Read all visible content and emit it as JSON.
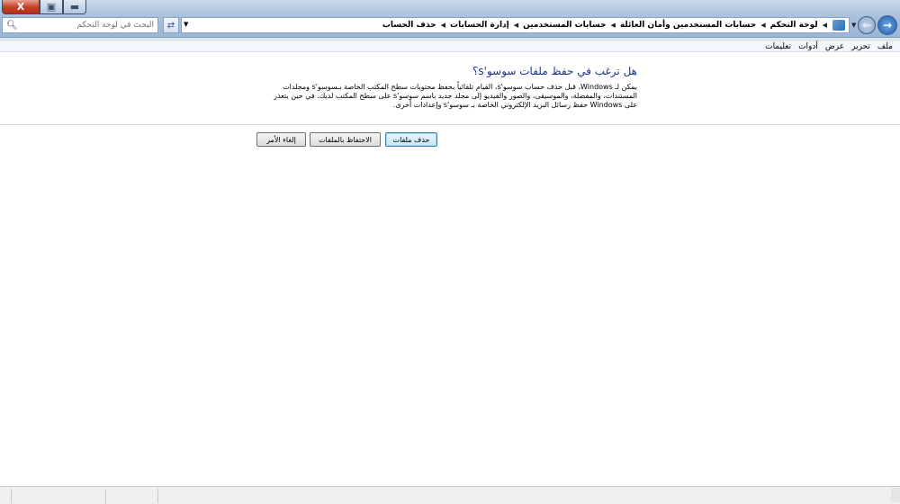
{
  "window": {
    "close_symbol": "X",
    "maximize_symbol": "▣",
    "minimize_symbol": "▬"
  },
  "search": {
    "placeholder": "البحث في لوحة التحكم"
  },
  "address": {
    "crumbs": [
      "لوحة التحكم",
      "حسابات المستخدمين وأمان العائلة",
      "حسابات المستخدمين",
      "إدارة الحسابات",
      "حذف الحساب"
    ]
  },
  "menu": {
    "items": [
      "ملف",
      "تحرير",
      "عرض",
      "أدوات",
      "تعليمات"
    ]
  },
  "main": {
    "heading": "هل ترغب في حفظ ملفات سوسو's؟",
    "description": "يمكن لـ Windows، قبل حذف حساب سوسو's، القيام تلقائياً بحفظ محتويات سطح المكتب الخاصة بـسوسو's ومجلدات المستندات، والمفضلة، والموسيقى، والصور والفيديو إلى مجلد جديد باسم سوسو's على سطح المكتب لديك. في حين يتعذر على Windows حفظ رسائل البريد الإلكتروني الخاصة بـ سوسو's وإعدادات أخرى."
  },
  "buttons": {
    "delete_files": "حذف ملفات",
    "keep_files": "الاحتفاظ بالملفات",
    "cancel": "إلغاء الأمر"
  },
  "colors": {
    "heading": "#1e3287",
    "titlebar": "#a9c1dd",
    "close": "#c7432c"
  }
}
